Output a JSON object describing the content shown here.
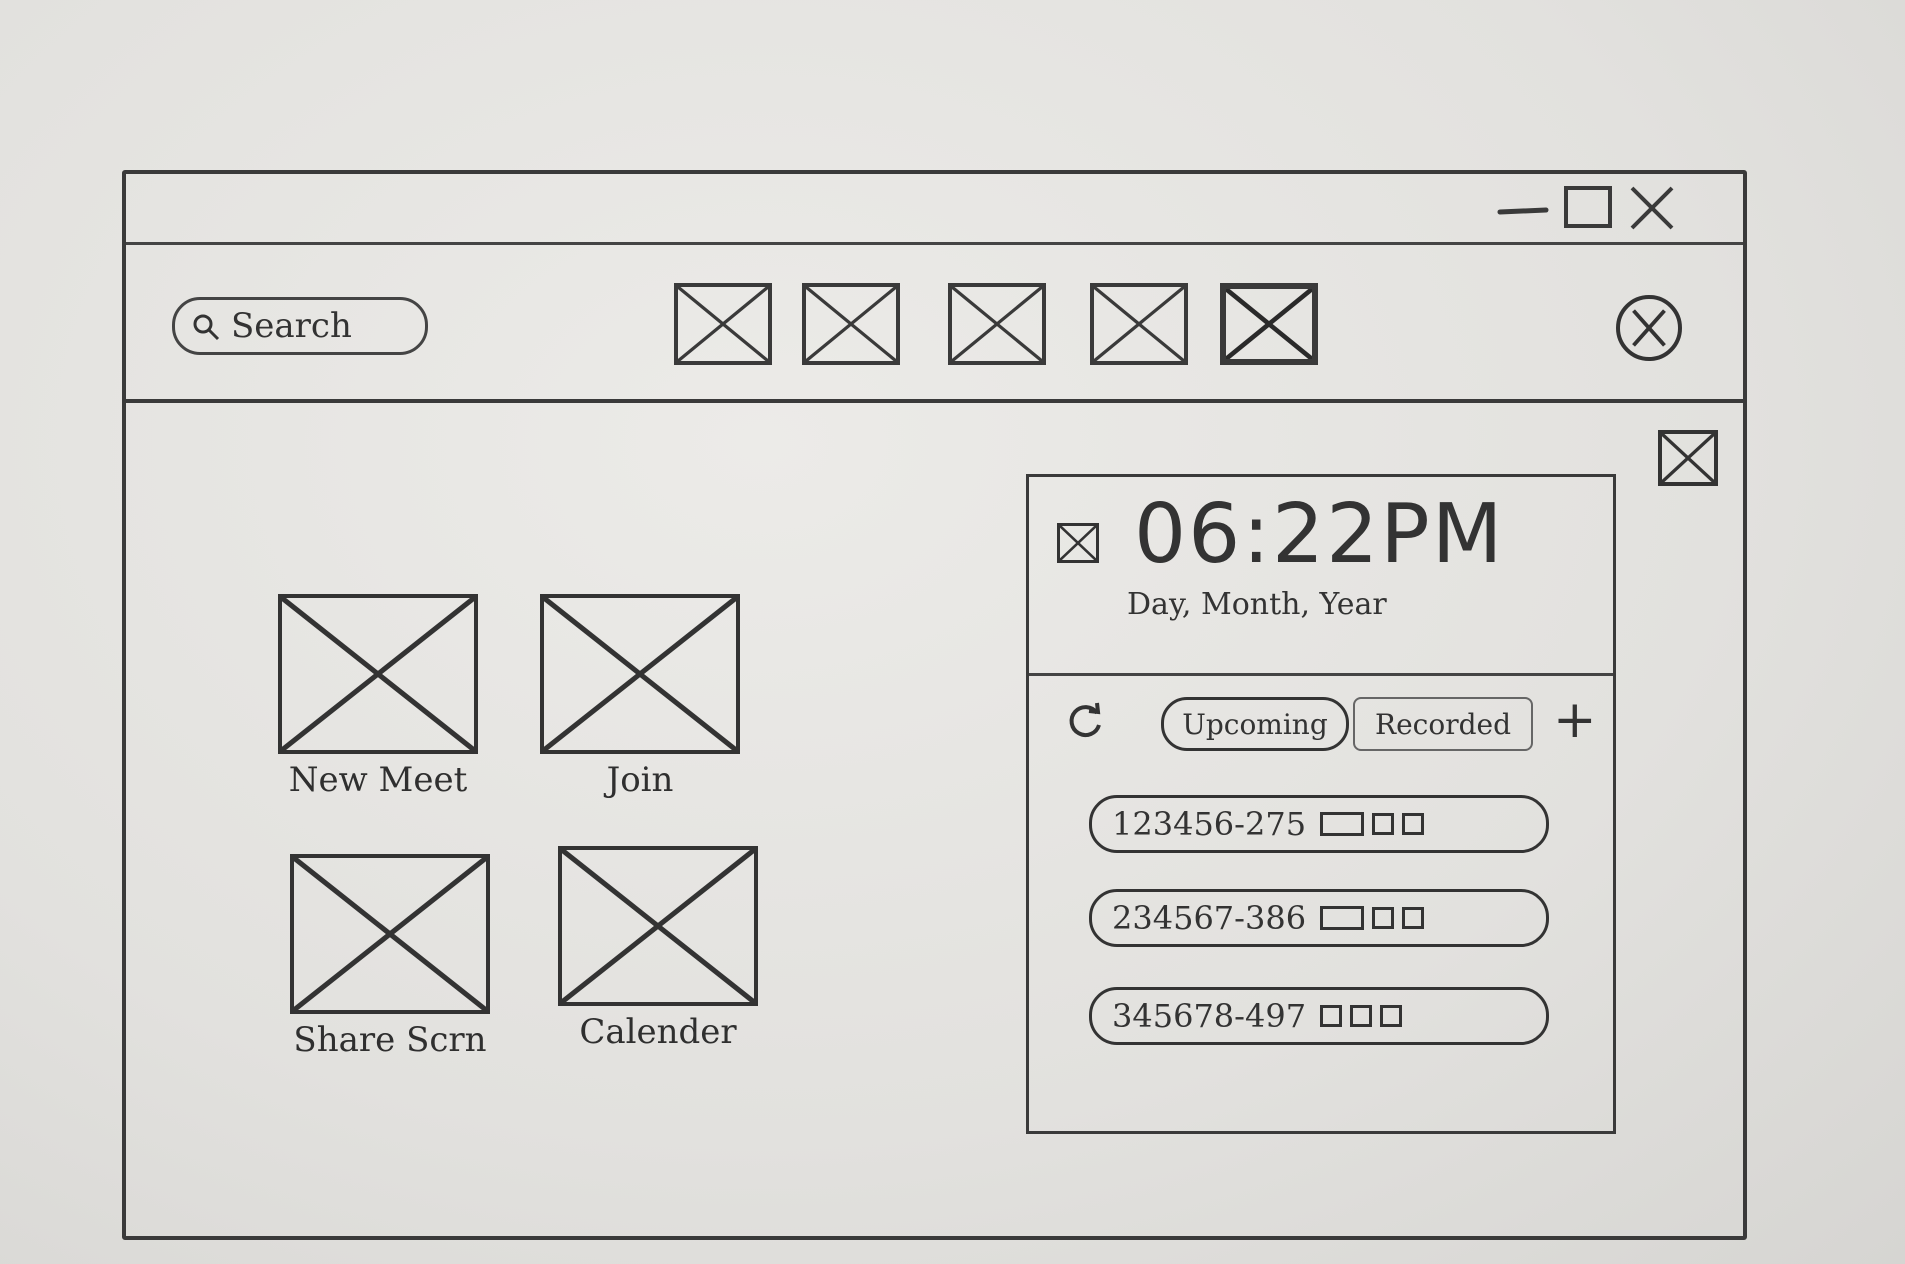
{
  "toolbar": {
    "search_label": "Search",
    "nav_buttons": [
      "nav-1",
      "nav-2",
      "nav-3",
      "nav-4",
      "nav-5"
    ]
  },
  "actions": [
    {
      "label": "New Meet"
    },
    {
      "label": "Join"
    },
    {
      "label": "Share Scrn"
    },
    {
      "label": "Calender"
    }
  ],
  "side_panel": {
    "time": "06:22PM",
    "date": "Day, Month, Year",
    "tabs": {
      "upcoming": "Upcoming",
      "recorded": "Recorded"
    },
    "add_label": "+",
    "meetings": [
      {
        "id": "123456-275"
      },
      {
        "id": "234567-386"
      },
      {
        "id": "345678-497"
      }
    ]
  }
}
